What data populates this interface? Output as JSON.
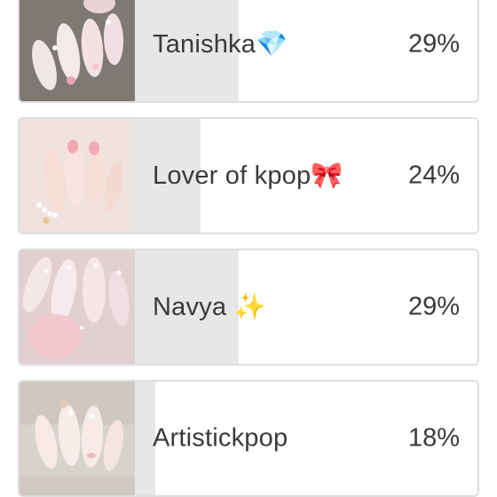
{
  "poll": {
    "options": [
      {
        "label": "Tanishka💎",
        "percent_label": "29%",
        "percent": 29,
        "thumbnail": "nail-art-photo"
      },
      {
        "label": "Lover of kpop🎀",
        "percent_label": "24%",
        "percent": 24,
        "thumbnail": "nail-art-photo"
      },
      {
        "label": "Navya ✨",
        "percent_label": "29%",
        "percent": 29,
        "thumbnail": "nail-art-photo"
      },
      {
        "label": "Artistickpop",
        "percent_label": "18%",
        "percent": 18,
        "thumbnail": "nail-art-photo"
      }
    ]
  },
  "colors": {
    "fill": "#e7e7e7",
    "border": "#dedede",
    "text": "#3a3a3a"
  }
}
